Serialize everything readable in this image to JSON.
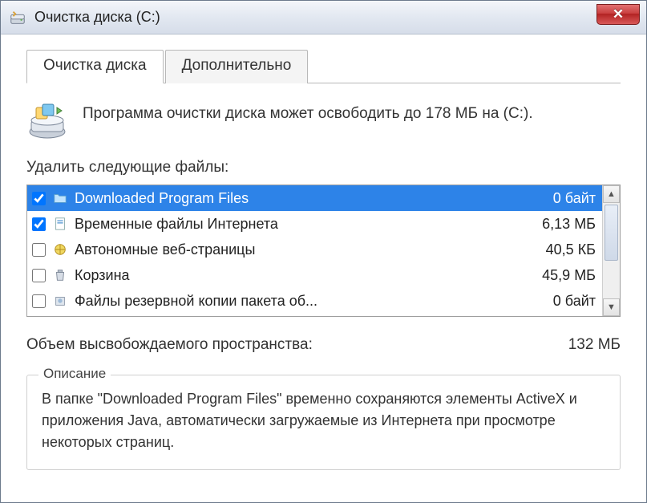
{
  "title": "Очистка диска  (C:)",
  "tabs": {
    "cleanup": "Очистка диска",
    "more": "Дополнительно"
  },
  "intro": "Программа очистки диска может освободить до 178 МБ на  (C:).",
  "list_label": "Удалить следующие файлы:",
  "files": [
    {
      "checked": true,
      "name": "Downloaded Program Files",
      "size": "0 байт"
    },
    {
      "checked": true,
      "name": "Временные файлы Интернета",
      "size": "6,13 МБ"
    },
    {
      "checked": false,
      "name": "Автономные веб-страницы",
      "size": "40,5 КБ"
    },
    {
      "checked": false,
      "name": "Корзина",
      "size": "45,9 МБ"
    },
    {
      "checked": false,
      "name": "Файлы резервной копии пакета об...",
      "size": "0 байт"
    }
  ],
  "freeable_label": "Объем высвобождаемого пространства:",
  "freeable_value": "132 МБ",
  "desc_legend": "Описание",
  "desc_text": "В папке \"Downloaded Program Files\" временно сохраняются элементы ActiveX и приложения Java, автоматически загружаемые из Интернета при просмотре некоторых страниц."
}
